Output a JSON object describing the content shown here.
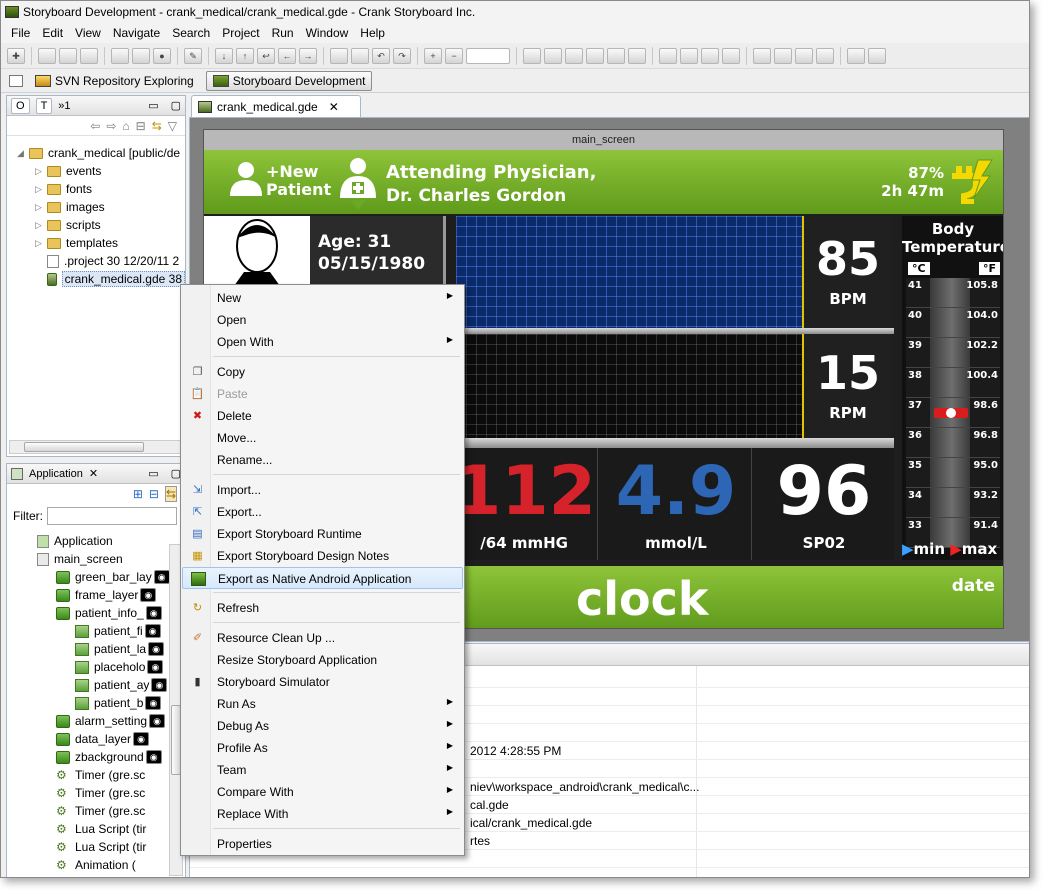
{
  "window": {
    "title": "Storyboard Development - crank_medical/crank_medical.gde - Crank Storyboard Inc."
  },
  "menubar": [
    "File",
    "Edit",
    "View",
    "Navigate",
    "Search",
    "Project",
    "Run",
    "Window",
    "Help"
  ],
  "perspectives": {
    "svn": "SVN Repository Exploring",
    "storyboard": "Storyboard Development"
  },
  "navigator": {
    "tabs": [
      "O",
      "T",
      "»1"
    ],
    "items": [
      {
        "label": "crank_medical [public/de",
        "type": "project"
      },
      {
        "label": "events",
        "type": "folder"
      },
      {
        "label": "fonts",
        "type": "folder"
      },
      {
        "label": "images",
        "type": "folder"
      },
      {
        "label": "scripts",
        "type": "folder"
      },
      {
        "label": "templates",
        "type": "folder"
      },
      {
        "label": ".project 30  12/20/11 2",
        "type": "file"
      },
      {
        "label": "crank_medical.gde 38",
        "type": "gde"
      }
    ]
  },
  "application_view": {
    "tab": "Application",
    "filter_label": "Filter:",
    "items": [
      {
        "label": "Application",
        "indent": 0,
        "kind": "box"
      },
      {
        "label": "main_screen",
        "indent": 0,
        "kind": "box"
      },
      {
        "label": "green_bar_lay",
        "indent": 1,
        "kind": "layer",
        "eye": true
      },
      {
        "label": "frame_layer",
        "indent": 1,
        "kind": "layer",
        "eye": true
      },
      {
        "label": "patient_info_",
        "indent": 1,
        "kind": "layer",
        "eye": true
      },
      {
        "label": "patient_fi",
        "indent": 2,
        "kind": "ctrl",
        "eye": true
      },
      {
        "label": "patient_la",
        "indent": 2,
        "kind": "ctrl",
        "eye": true
      },
      {
        "label": "placeholo",
        "indent": 2,
        "kind": "ctrl",
        "eye": true
      },
      {
        "label": "patient_ay",
        "indent": 2,
        "kind": "ctrl",
        "eye": true
      },
      {
        "label": "patient_b",
        "indent": 2,
        "kind": "ctrl",
        "eye": true
      },
      {
        "label": "alarm_setting",
        "indent": 1,
        "kind": "layer",
        "eye": true
      },
      {
        "label": "data_layer",
        "indent": 1,
        "kind": "layer",
        "eye": true
      },
      {
        "label": "zbackground",
        "indent": 1,
        "kind": "layer",
        "eye": true
      },
      {
        "label": "Timer (gre.sc",
        "indent": 1,
        "kind": "script"
      },
      {
        "label": "Timer (gre.sc",
        "indent": 1,
        "kind": "script"
      },
      {
        "label": "Timer (gre.sc",
        "indent": 1,
        "kind": "script"
      },
      {
        "label": "Lua Script (tir",
        "indent": 1,
        "kind": "script"
      },
      {
        "label": "Lua Script (tir",
        "indent": 1,
        "kind": "script"
      },
      {
        "label": "Animation (",
        "indent": 1,
        "kind": "script"
      }
    ]
  },
  "editor": {
    "tab": "crank_medical.gde",
    "screen_title": "main_screen",
    "header": {
      "new_patient_1": "+New",
      "new_patient_2": "Patient",
      "physician_1": "Attending Physician,",
      "physician_2": "Dr. Charles Gordon",
      "battery_pct": "87%",
      "battery_time": "2h 47m"
    },
    "patient": {
      "age": "Age: 31",
      "dob": "05/15/1980"
    },
    "vitals": {
      "hr_value": "85",
      "hr_unit": "BPM",
      "rr_value": "15",
      "rr_unit": "RPM",
      "bp_value": "112",
      "bp_unit": "/64 mmHG",
      "glucose_value": "4.9",
      "glucose_unit": "mmol/L",
      "spo2_value": "96",
      "spo2_unit": "SP02"
    },
    "temperature": {
      "title_1": "Body",
      "title_2": "Temperature",
      "celsius": "°C",
      "fahrenheit": "°F",
      "rows": [
        {
          "c": "41",
          "f": "105.8"
        },
        {
          "c": "40",
          "f": "104.0"
        },
        {
          "c": "39",
          "f": "102.2"
        },
        {
          "c": "38",
          "f": "100.4"
        },
        {
          "c": "37",
          "f": "98.6"
        },
        {
          "c": "36",
          "f": "96.8"
        },
        {
          "c": "35",
          "f": "95.0"
        },
        {
          "c": "34",
          "f": "93.2"
        },
        {
          "c": "33",
          "f": "91.4"
        }
      ],
      "min": "min",
      "max": "max"
    },
    "footer": {
      "clock": "clock",
      "date": "date"
    }
  },
  "properties": [
    {
      "value": ""
    },
    {
      "value": ""
    },
    {
      "value": ""
    },
    {
      "value": ""
    },
    {
      "value": "2012 4:28:55 PM"
    },
    {
      "value": ""
    },
    {
      "value": "niev\\workspace_android\\crank_medical\\c..."
    },
    {
      "value": "cal.gde"
    },
    {
      "value": "ical/crank_medical.gde"
    },
    {
      "value": "rtes"
    },
    {
      "value": ""
    }
  ],
  "context_menu": [
    {
      "label": "New",
      "submenu": true,
      "icon": ""
    },
    {
      "label": "Open",
      "icon": ""
    },
    {
      "label": "Open With",
      "submenu": true,
      "icon": ""
    },
    {
      "sep": true
    },
    {
      "label": "Copy",
      "icon": "copy-icon"
    },
    {
      "label": "Paste",
      "icon": "paste-icon",
      "disabled": true
    },
    {
      "label": "Delete",
      "icon": "delete-icon"
    },
    {
      "label": "Move...",
      "icon": ""
    },
    {
      "label": "Rename...",
      "icon": ""
    },
    {
      "sep": true
    },
    {
      "label": "Import...",
      "icon": "import-icon"
    },
    {
      "label": "Export...",
      "icon": "export-icon"
    },
    {
      "label": "Export Storyboard Runtime",
      "icon": "runtime-icon"
    },
    {
      "label": "Export Storyboard Design Notes",
      "icon": "notes-icon"
    },
    {
      "label": "Export as Native Android Application",
      "icon": "android-icon",
      "highlight": true
    },
    {
      "sep": true
    },
    {
      "label": "Refresh",
      "icon": "refresh-icon"
    },
    {
      "sep": true
    },
    {
      "label": "Resource Clean Up ...",
      "icon": "broom-icon"
    },
    {
      "label": "Resize Storyboard Application",
      "icon": ""
    },
    {
      "label": "Storyboard Simulator",
      "icon": "simulator-icon"
    },
    {
      "label": "Run As",
      "submenu": true,
      "icon": ""
    },
    {
      "label": "Debug As",
      "submenu": true,
      "icon": ""
    },
    {
      "label": "Profile As",
      "submenu": true,
      "icon": ""
    },
    {
      "label": "Team",
      "submenu": true,
      "icon": ""
    },
    {
      "label": "Compare With",
      "submenu": true,
      "icon": ""
    },
    {
      "label": "Replace With",
      "submenu": true,
      "icon": ""
    },
    {
      "sep": true
    },
    {
      "label": "Properties",
      "icon": ""
    }
  ],
  "colors": {
    "accent_green": "#7ab532",
    "bp_red": "#d6232b",
    "glucose_blue": "#2c66b5",
    "highlight": "#d6e8fb"
  }
}
